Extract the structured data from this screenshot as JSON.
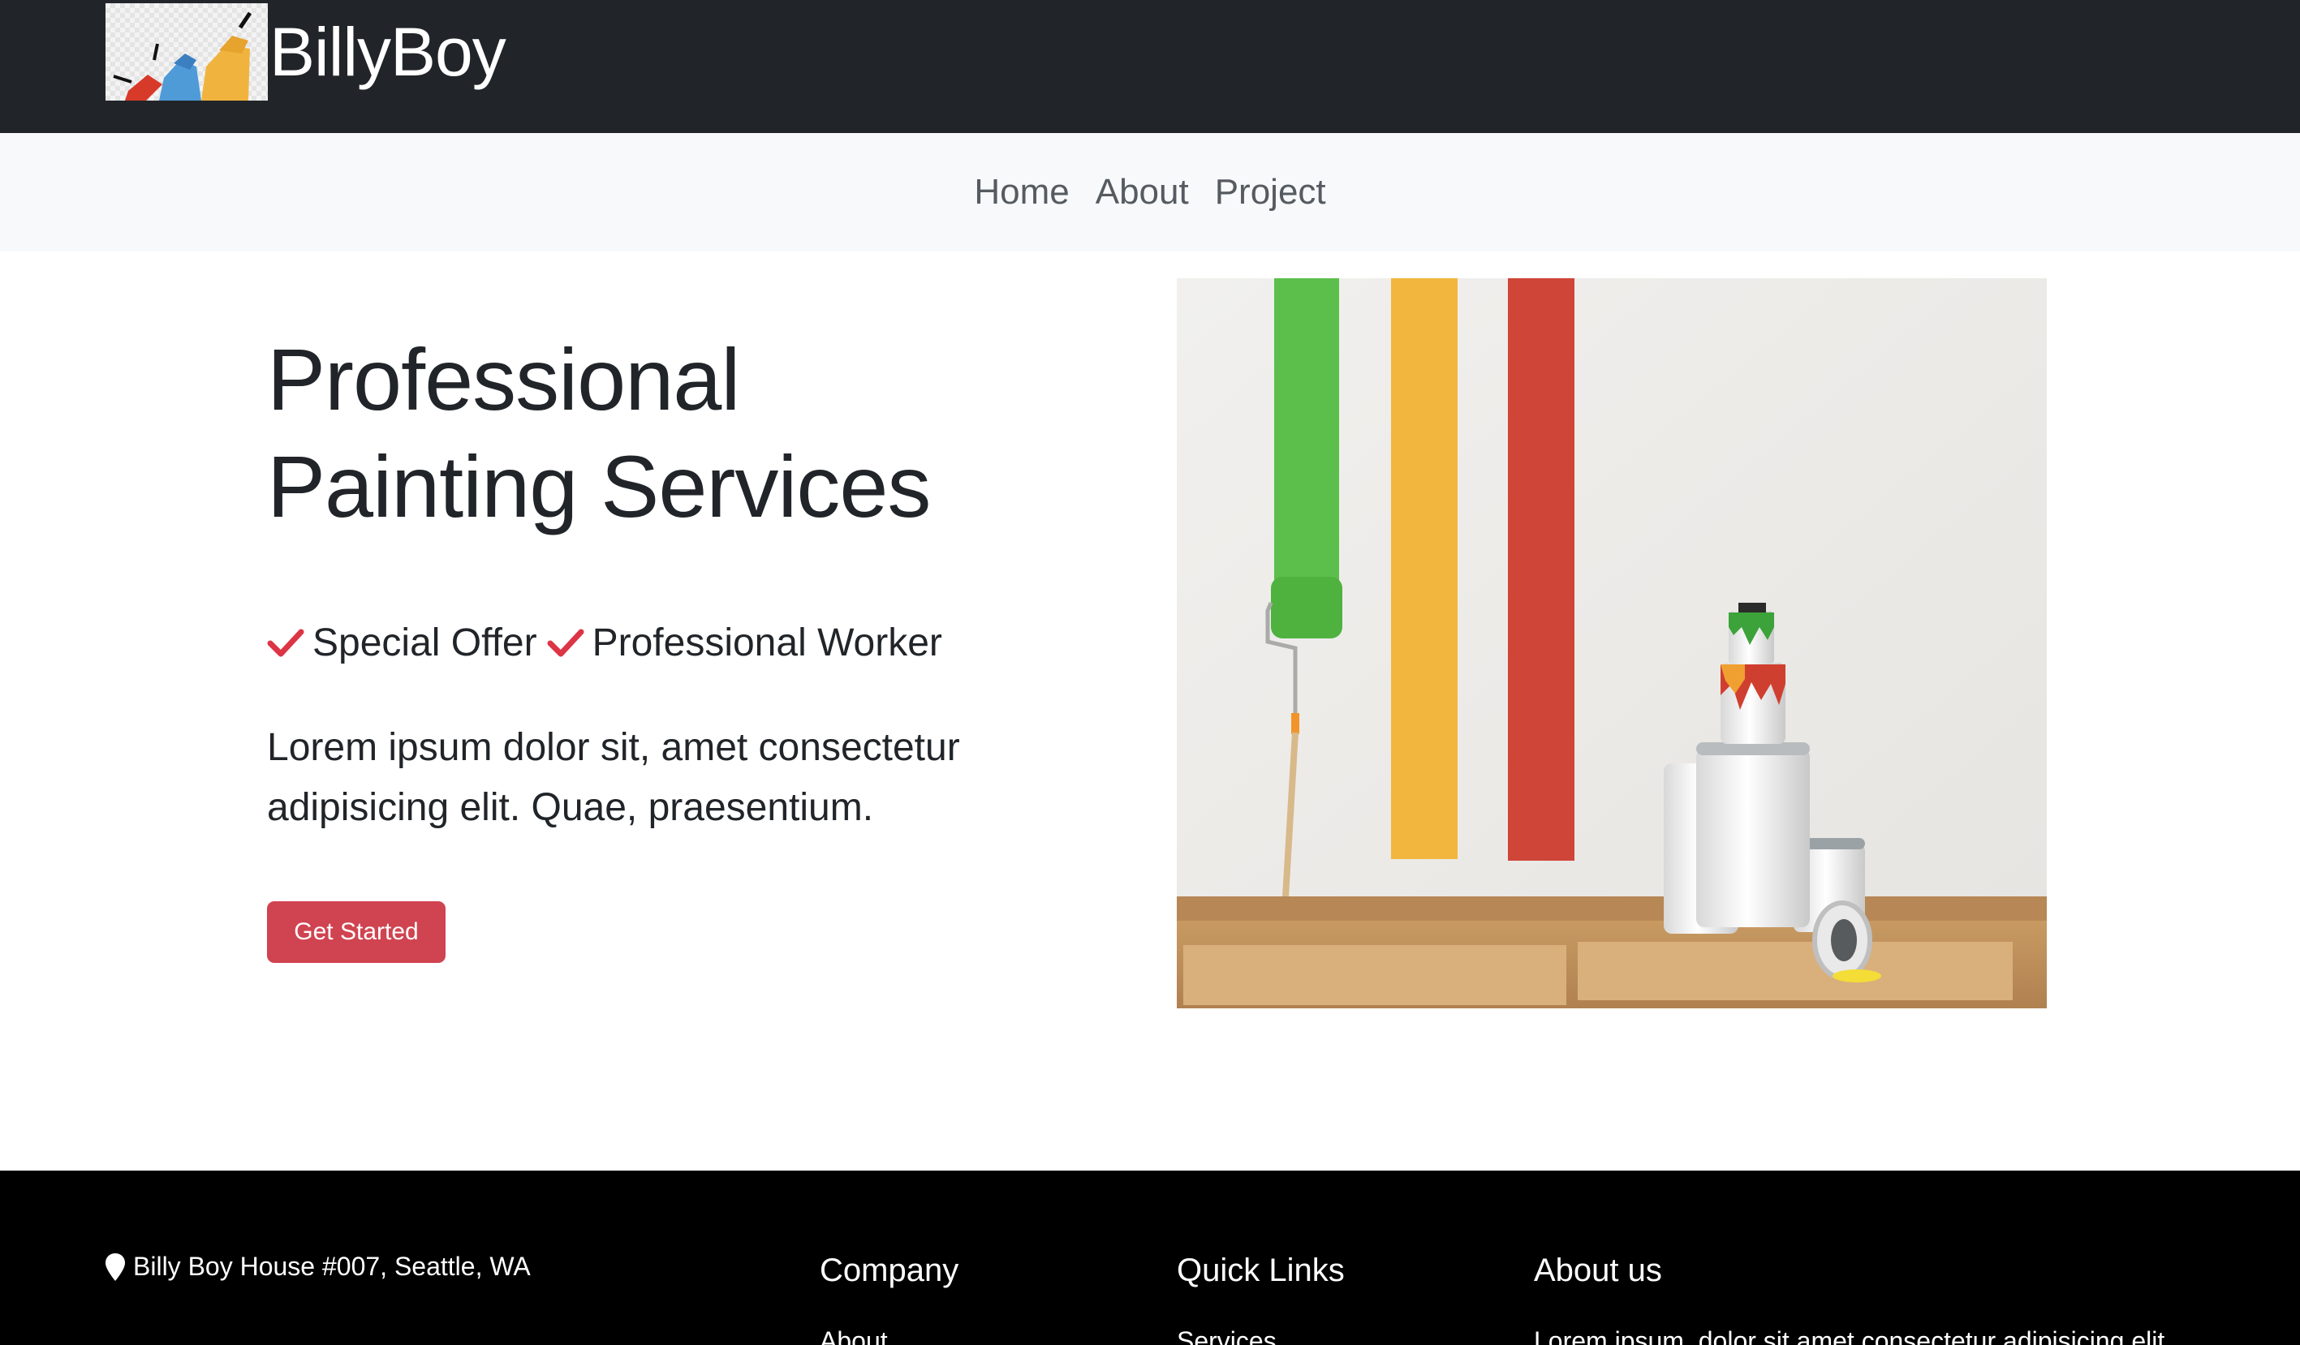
{
  "header": {
    "brand": "BillyBoy",
    "logo_icon": "paint-rollers-logo-icon",
    "background": "#212529"
  },
  "nav": {
    "items": [
      {
        "label": "Home"
      },
      {
        "label": "About"
      },
      {
        "label": "Project"
      }
    ]
  },
  "hero": {
    "title_line1": "Professional",
    "title_line2": "Painting Services",
    "features": [
      {
        "icon": "checkmark-icon",
        "label": "Special Offer"
      },
      {
        "icon": "checkmark-icon",
        "label": "Professional Worker"
      }
    ],
    "description": "Lorem ipsum dolor sit, amet consectetur adipisicing elit. Quae, praesentium.",
    "cta_label": "Get Started",
    "cta_color": "#d04350",
    "check_color": "#dc3545",
    "image_icon": "painted-wall-image"
  },
  "footer": {
    "address": "Billy Boy House #007, Seattle, WA",
    "address_icon": "map-pin-icon",
    "columns": [
      {
        "title": "Company",
        "first_item": "About"
      },
      {
        "title": "Quick Links",
        "first_item": "Services"
      },
      {
        "title": "About us",
        "first_item": "Lorem ipsum, dolor sit amet consectetur adipisicing elit."
      }
    ]
  }
}
